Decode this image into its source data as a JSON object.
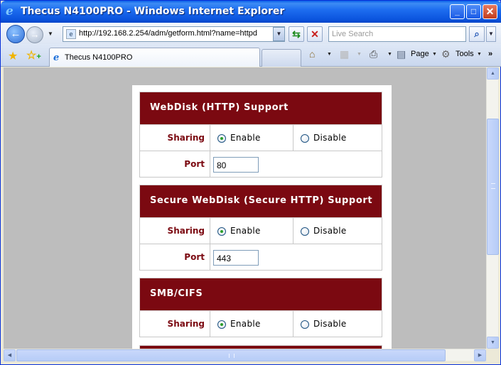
{
  "window": {
    "title": "Thecus N4100PRO - Windows Internet Explorer",
    "minimize": "_",
    "maximize": "□",
    "close": "✕"
  },
  "address": {
    "url": "http://192.168.2.254/adm/getform.html?name=httpd",
    "search_placeholder": "Live Search"
  },
  "tab": {
    "label": "Thecus N4100PRO"
  },
  "commands": {
    "page": "Page",
    "tools": "Tools"
  },
  "sections": [
    {
      "title": "WebDisk (HTTP) Support",
      "sharing_label": "Sharing",
      "enable_label": "Enable",
      "disable_label": "Disable",
      "selected": "Enable",
      "port_label": "Port",
      "port_value": "80"
    },
    {
      "title": "Secure WebDisk (Secure HTTP) Support",
      "sharing_label": "Sharing",
      "enable_label": "Enable",
      "disable_label": "Disable",
      "selected": "Enable",
      "port_label": "Port",
      "port_value": "443"
    },
    {
      "title": "SMB/CIFS",
      "sharing_label": "Sharing",
      "enable_label": "Enable",
      "disable_label": "Disable",
      "selected": "Enable"
    }
  ],
  "colors": {
    "section_header": "#7b0911",
    "label_text": "#7b0911",
    "radio_selected": "#2a9d2a"
  }
}
